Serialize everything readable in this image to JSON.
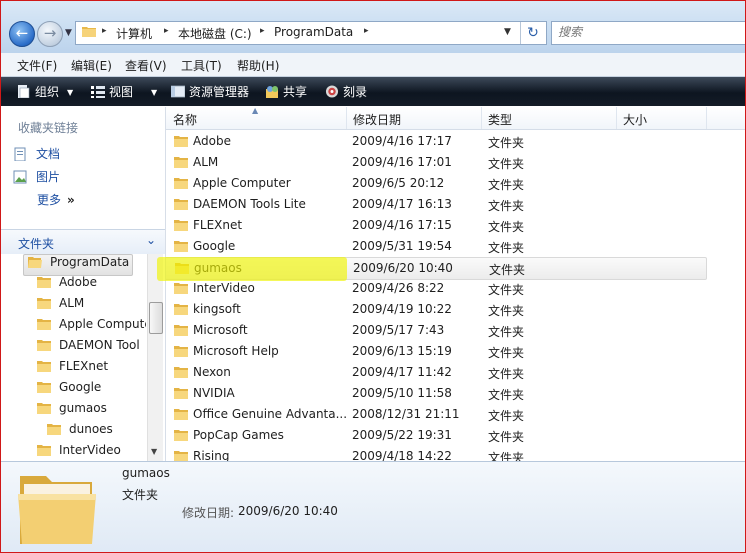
{
  "address": {
    "crumbs": [
      "计算机",
      "本地磁盘 (C:)",
      "ProgramData"
    ],
    "search_placeholder": "搜索"
  },
  "menu": [
    "文件(F)",
    "编辑(E)",
    "查看(V)",
    "工具(T)",
    "帮助(H)"
  ],
  "commands": {
    "organize": "组织",
    "views": "视图",
    "explorer": "资源管理器",
    "share": "共享",
    "burn": "刻录"
  },
  "sidebar": {
    "favorites_header": "收藏夹链接",
    "links": [
      "文档",
      "图片"
    ],
    "more": "更多",
    "more_arrows": "»",
    "folders_header": "文件夹",
    "tree": [
      {
        "label": "ProgramData",
        "level": 0,
        "selected": true
      },
      {
        "label": "Adobe",
        "level": 1
      },
      {
        "label": "ALM",
        "level": 1
      },
      {
        "label": "Apple Compute",
        "level": 1
      },
      {
        "label": "DAEMON Tool",
        "level": 1
      },
      {
        "label": "FLEXnet",
        "level": 1
      },
      {
        "label": "Google",
        "level": 1
      },
      {
        "label": "gumaos",
        "level": 1
      },
      {
        "label": "dunoes",
        "level": 2
      },
      {
        "label": "InterVideo",
        "level": 1
      }
    ]
  },
  "columns": [
    "名称",
    "修改日期",
    "类型",
    "大小"
  ],
  "files": [
    {
      "name": "Adobe",
      "date": "2009/4/16 17:17",
      "type": "文件夹"
    },
    {
      "name": "ALM",
      "date": "2009/4/16 17:01",
      "type": "文件夹"
    },
    {
      "name": "Apple Computer",
      "date": "2009/6/5 20:12",
      "type": "文件夹"
    },
    {
      "name": "DAEMON Tools Lite",
      "date": "2009/4/17 16:13",
      "type": "文件夹"
    },
    {
      "name": "FLEXnet",
      "date": "2009/4/16 17:15",
      "type": "文件夹"
    },
    {
      "name": "Google",
      "date": "2009/5/31 19:54",
      "type": "文件夹"
    },
    {
      "name": "gumaos",
      "date": "2009/6/20 10:40",
      "type": "文件夹",
      "selected": true
    },
    {
      "name": "InterVideo",
      "date": "2009/4/26 8:22",
      "type": "文件夹"
    },
    {
      "name": "kingsoft",
      "date": "2009/4/19 10:22",
      "type": "文件夹"
    },
    {
      "name": "Microsoft",
      "date": "2009/5/17 7:43",
      "type": "文件夹"
    },
    {
      "name": "Microsoft Help",
      "date": "2009/6/13 15:19",
      "type": "文件夹"
    },
    {
      "name": "Nexon",
      "date": "2009/4/17 11:42",
      "type": "文件夹"
    },
    {
      "name": "NVIDIA",
      "date": "2009/5/10 11:58",
      "type": "文件夹"
    },
    {
      "name": "Office Genuine Advanta...",
      "date": "2008/12/31 21:11",
      "type": "文件夹"
    },
    {
      "name": "PopCap Games",
      "date": "2009/5/22 19:31",
      "type": "文件夹"
    },
    {
      "name": "Rising",
      "date": "2009/4/18 14:22",
      "type": "文件夹"
    }
  ],
  "details": {
    "name": "gumaos",
    "type": "文件夹",
    "modified_label": "修改日期:",
    "modified_value": "2009/6/20 10:40"
  },
  "colors": {
    "accent": "#1e4fa2",
    "highlight": "#f0f500",
    "window_border": "#d01818",
    "folder": "#f3c95a"
  }
}
